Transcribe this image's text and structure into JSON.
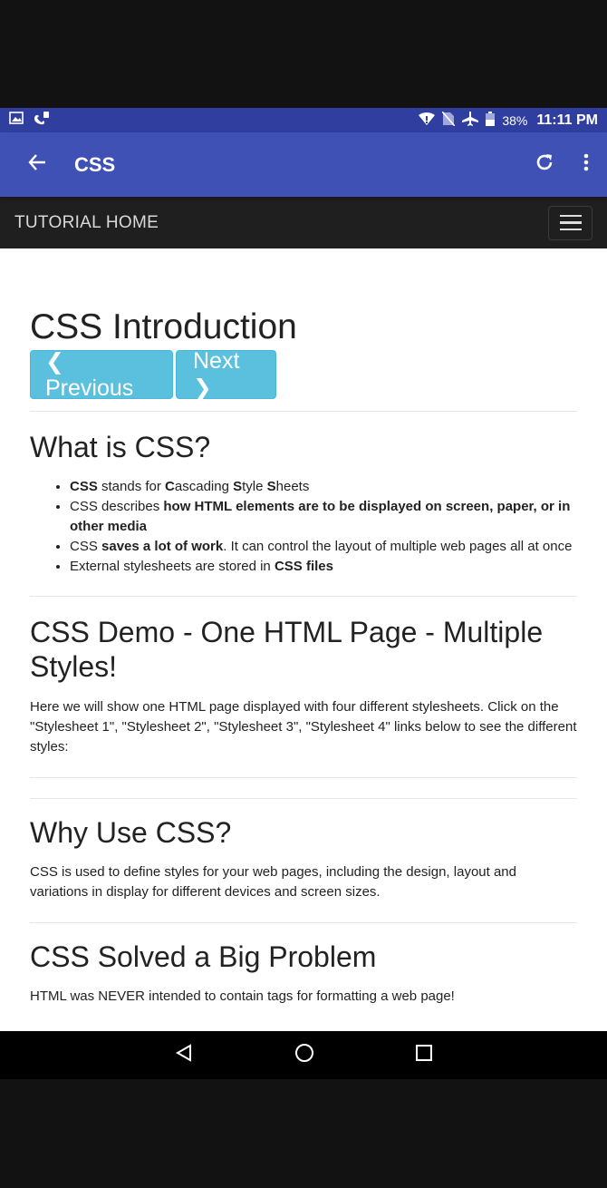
{
  "status_bar": {
    "battery": "38%",
    "time": "11:11 PM"
  },
  "app_bar": {
    "title": "CSS"
  },
  "web_nav": {
    "home": "TUTORIAL HOME"
  },
  "page": {
    "title": "CSS Introduction",
    "prev_label": "❮ Previous",
    "next_label": "Next ❯",
    "section1": {
      "heading": "What is CSS?",
      "b1": {
        "l1": "CSS",
        "t1": " stands for ",
        "l2": "C",
        "t2": "ascading ",
        "l3": "S",
        "t3": "tyle ",
        "l4": "S",
        "t4": "heets"
      },
      "b2": {
        "t1": "CSS describes ",
        "b": "how HTML elements are to be displayed on screen, paper, or in other media"
      },
      "b3": {
        "t1": "CSS ",
        "b": "saves a lot of work",
        "t2": ". It can control the layout of multiple web pages all at once"
      },
      "b4": {
        "t1": "External stylesheets are stored in ",
        "b": "CSS files"
      }
    },
    "section2": {
      "heading": "CSS Demo - One HTML Page - Multiple Styles!",
      "text": "Here we will show one HTML page displayed with four different stylesheets. Click on the \"Stylesheet 1\", \"Stylesheet 2\", \"Stylesheet 3\", \"Stylesheet 4\" links below to see the different styles:"
    },
    "section3": {
      "heading": "Why Use CSS?",
      "text": "CSS is used to define styles for your web pages, including the design, layout and variations in display for different devices and screen sizes."
    },
    "section4": {
      "heading": "CSS Solved a Big Problem",
      "text": "HTML was NEVER intended to contain tags for formatting a web page!"
    }
  },
  "colors": {
    "status_bar": "#303f9f",
    "app_bar": "#3f51b5",
    "web_nav": "#1f1f1f",
    "button": "#5bc0de"
  }
}
